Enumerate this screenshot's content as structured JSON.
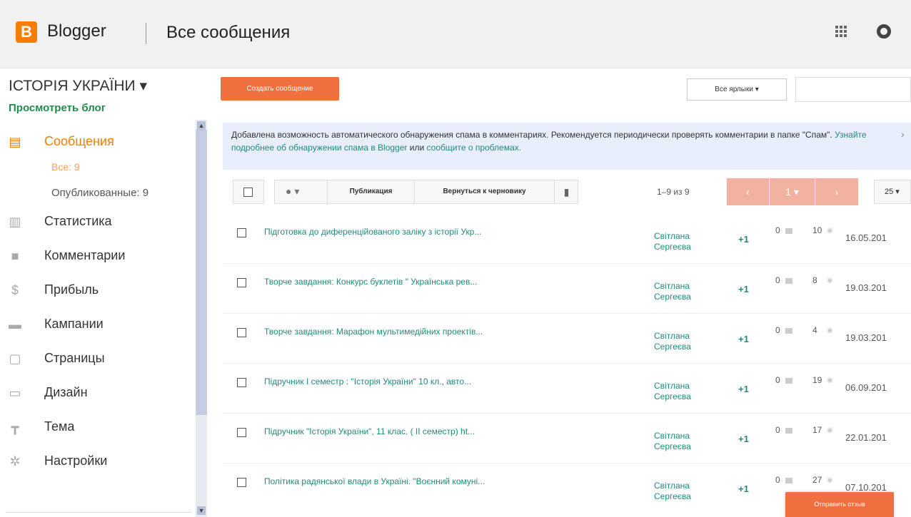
{
  "header": {
    "logo_letter": "B",
    "brand": "Blogger",
    "page_title": "Все сообщения"
  },
  "blog": {
    "name": "ІСТОРІЯ УКРАЇНИ ▾",
    "view_link": "Просмотреть блог"
  },
  "sidebar": {
    "items": [
      {
        "label": "Сообщения",
        "icon": "posts-icon"
      },
      {
        "label": "Статистика",
        "icon": "stats-icon"
      },
      {
        "label": "Комментарии",
        "icon": "comments-icon"
      },
      {
        "label": "Прибыль",
        "icon": "dollar-icon"
      },
      {
        "label": "Кампании",
        "icon": "campaigns-icon"
      },
      {
        "label": "Страницы",
        "icon": "pages-icon"
      },
      {
        "label": "Дизайн",
        "icon": "layout-icon"
      },
      {
        "label": "Тема",
        "icon": "theme-icon"
      },
      {
        "label": "Настройки",
        "icon": "gear-icon"
      }
    ],
    "sub_all": "Все: 9",
    "sub_published": "Опубликованные: 9"
  },
  "main": {
    "create_button": "Создать сообщение",
    "labels_dropdown": "Все ярлыки ▾",
    "banner": {
      "text": "Добавлена возможность автоматического обнаружения спама в комментариях. Рекомендуется периодически проверять комментарии в папке \"Спам\".",
      "link1": "Узнайте подробнее об обнаружении спама в Blogger",
      "or": "или",
      "link2": "сообщите о проблемах."
    },
    "toolbar": {
      "publish": "Публикация",
      "revert": "Вернуться к черновику",
      "count": "1–9 из 9",
      "page": "1 ▾",
      "per_page": "25 ▾"
    },
    "posts": [
      {
        "title": "Підготовка до диференційованого заліку з історії Укр...",
        "author": "Світлана Сергеєва",
        "plus": "+1",
        "comments": "0",
        "views": "10",
        "date": "16.05.201"
      },
      {
        "title": "Творче завдання: Конкурс буклетів  \" Українська рев...",
        "author": "Світлана Сергеєва",
        "plus": "+1",
        "comments": "0",
        "views": "8",
        "date": "19.03.201"
      },
      {
        "title": "Творче завдання: Марафон мультимедійних проектів...",
        "author": "Світлана Сергеєва",
        "plus": "+1",
        "comments": "0",
        "views": "4",
        "date": "19.03.201"
      },
      {
        "title": "Підручник І семестр  : \"Історія України\" 10 кл.,  авто...",
        "author": "Світлана Сергеєва",
        "plus": "+1",
        "comments": "0",
        "views": "19",
        "date": "06.09.201"
      },
      {
        "title": "Підручник \"Історія України\", 11 клас.   ( ІІ семестр) ht...",
        "author": "Світлана Сергеєва",
        "plus": "+1",
        "comments": "0",
        "views": "17",
        "date": "22.01.201"
      },
      {
        "title": "Політика радянської влади в Україні. \"Воєнний комуні...",
        "author": "Світлана Сергеєва",
        "plus": "+1",
        "comments": "0",
        "views": "27",
        "date": "07.10.201"
      }
    ],
    "feedback_button": "Отправить отзыв"
  },
  "colors": {
    "accent": "#f57d00",
    "button": "#f06f3e",
    "link": "#208a7a",
    "banner_bg": "#e8eefa"
  }
}
